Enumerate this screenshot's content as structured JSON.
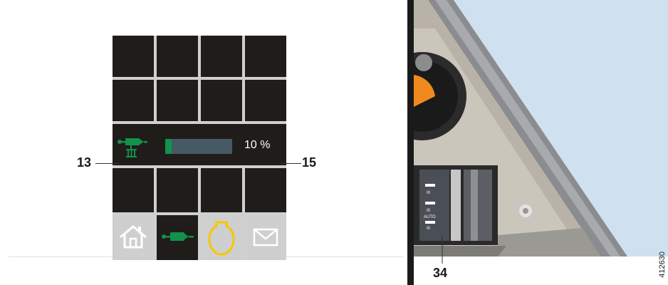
{
  "display": {
    "callouts": {
      "left": "13",
      "right": "15"
    },
    "progress": {
      "percent_text": "10 %",
      "fill_fraction": 0.1
    },
    "bottom_bar": {
      "buttons": [
        {
          "icon": "home-icon",
          "active": false
        },
        {
          "icon": "auxiliary-heater-icon",
          "active": true
        },
        {
          "icon": "engine-icon",
          "active": false
        },
        {
          "icon": "envelope-icon",
          "active": false
        }
      ]
    },
    "heater_level_icon": "heater-level-3-icon"
  },
  "photo": {
    "callout": "34",
    "switch_labels": [
      "III",
      "III",
      "AUTO"
    ],
    "document_id": "412630"
  },
  "colors": {
    "screen_bg": "#1f1c1a",
    "grid_gap": "#d0d0d0",
    "accent_green": "#12924a",
    "progress_track": "#455a64",
    "engine_yellow": "#f7c600",
    "sky": "#cfe1ef"
  }
}
